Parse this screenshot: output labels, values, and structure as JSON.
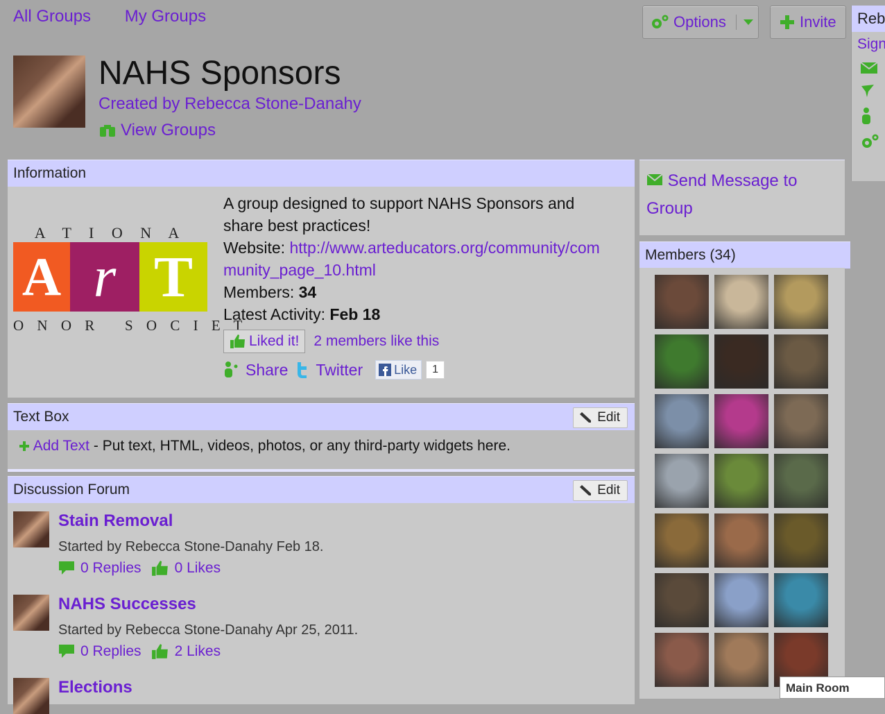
{
  "nav": {
    "all_groups": "All Groups",
    "my_groups": "My Groups"
  },
  "toolbar": {
    "options_label": "Options",
    "invite_label": "Invite"
  },
  "edge_panel": {
    "name_partial": "Reb",
    "sign_partial": "Sign",
    "icons": [
      "envelope-icon",
      "pin-icon",
      "person-icon",
      "gear-icon"
    ]
  },
  "group": {
    "title": "NAHS Sponsors",
    "created_by": "Created by Rebecca Stone-Danahy",
    "view_groups": "View Groups"
  },
  "information": {
    "heading": "Information",
    "logo": {
      "top": "A T I O N A",
      "bottom": "O N O R   S O C I E T",
      "letters": [
        "A",
        "r",
        "T"
      ],
      "colors": [
        "#f15a22",
        "#9e1f63",
        "#c9d400"
      ]
    },
    "description": "A group designed to support NAHS Sponsors and share best practices!",
    "website_label": "Website: ",
    "website_url": "http://www.arteducators.org/community/community_page_10.html",
    "members_label": "Members: ",
    "members_value": "34",
    "activity_label": "Latest Activity: ",
    "activity_value": "Feb 18",
    "liked_label": "Liked it!",
    "likes_text": "2 members like this",
    "share_label": "Share",
    "twitter_label": "Twitter",
    "fb_like_label": "Like",
    "fb_like_count": "1"
  },
  "textbox": {
    "heading": "Text Box",
    "edit_label": "Edit",
    "add_text_label": "Add Text",
    "body_text": " - Put text, HTML, videos, photos, or any third-party widgets here."
  },
  "forum": {
    "heading": "Discussion Forum",
    "edit_label": "Edit",
    "topics": [
      {
        "title": "Stain Removal",
        "meta": "Started by Rebecca Stone-Danahy Feb 18.",
        "replies": "0 Replies",
        "likes": "0 Likes"
      },
      {
        "title": "NAHS Successes",
        "meta": "Started by Rebecca Stone-Danahy Apr 25, 2011.",
        "replies": "0 Replies",
        "likes": "2 Likes"
      },
      {
        "title": "Elections",
        "meta": "",
        "replies": "",
        "likes": ""
      }
    ]
  },
  "sidebar": {
    "send_message": "Send Message to Group",
    "members_heading": "Members (34)"
  },
  "member_photos": [
    "#6b4a3a",
    "#c9b79a",
    "#b39a5e",
    "#3f7a2e",
    "#3a2a22",
    "#6b5a44",
    "#7c8fa8",
    "#b43a8c",
    "#7d6a55",
    "#9aa3ad",
    "#6a8a3a",
    "#5a6a4a",
    "#8a6a3a",
    "#9a6a4a",
    "#6a5a2a",
    "#5a4a3a",
    "#8aa0c8",
    "#3a8aa8",
    "#8a5a4a",
    "#a07a5a",
    "#7a3a2a"
  ],
  "chat": {
    "main_room": "Main Room"
  }
}
